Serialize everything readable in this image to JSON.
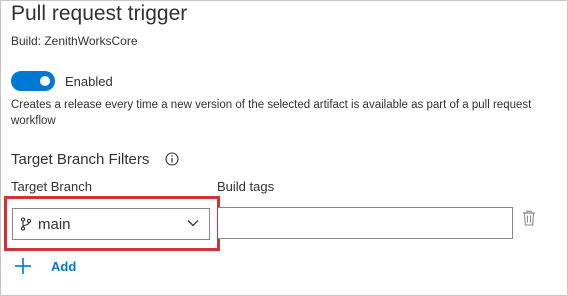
{
  "panel": {
    "title": "Pull request trigger",
    "subtitle": "Build: ZenithWorksCore"
  },
  "toggle": {
    "state": "on",
    "label": "Enabled",
    "color": "#0078d4"
  },
  "description": "Creates a release every time a new version of the selected artifact is available as part of a pull request workflow",
  "filters": {
    "section_title": "Target Branch Filters",
    "branch_label": "Target Branch",
    "tags_label": "Build tags",
    "branch_value": "main",
    "tags_value": "",
    "highlight_color": "#d13438"
  },
  "add_label": "Add",
  "icons": {
    "info": "info-icon",
    "branch": "git-branch-icon",
    "chevron": "chevron-down-icon",
    "trash": "trash-icon",
    "plus": "plus-icon"
  }
}
